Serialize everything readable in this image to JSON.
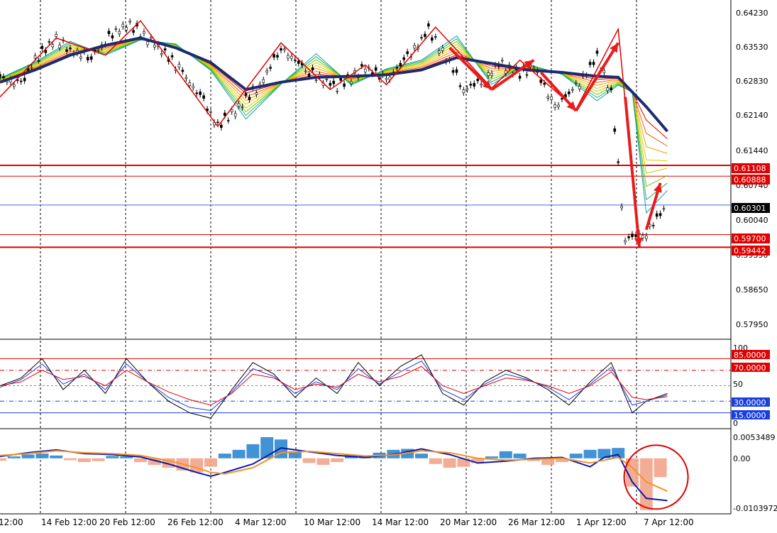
{
  "chart_data": {
    "type": "line",
    "title": "",
    "subtitle": "",
    "x_tick_labels": [
      "12:00",
      "14 Feb 12:00",
      "20 Feb 12:00",
      "26 Feb 12:00",
      "4 Mar 12:00",
      "10 Mar 12:00",
      "14 Mar 12:00",
      "20 Mar 12:00",
      "26 Mar 12:00",
      "1 Apr 12:00",
      "7 Apr 12:00"
    ],
    "price_panel": {
      "type": "line",
      "y_range": [
        0.576,
        0.644
      ],
      "y_tick_labels": [
        "0.64230",
        "0.63530",
        "0.62830",
        "0.62140",
        "0.61440",
        "0.60740",
        "0.60040",
        "0.59350",
        "0.58650",
        "0.57950"
      ],
      "y_tick_values": [
        0.6423,
        0.6353,
        0.6283,
        0.6214,
        0.6144,
        0.6074,
        0.6004,
        0.5935,
        0.5865,
        0.5795
      ],
      "grid": "vertical-dashed",
      "horizontal_levels": [
        {
          "value": 0.61108,
          "label": "0.61108",
          "color": "#e00000",
          "style": "solid-thick"
        },
        {
          "value": 0.60888,
          "label": "0.60888",
          "color": "#e00000",
          "style": "solid"
        },
        {
          "value": 0.60301,
          "label": "0.60301",
          "color": "#3a6fd8",
          "style": "current-price"
        },
        {
          "value": 0.597,
          "label": "0.59700",
          "color": "#e00000",
          "style": "solid"
        },
        {
          "value": 0.59442,
          "label": "0.59442",
          "color": "#e00000",
          "style": "solid-thick"
        }
      ],
      "series": [
        {
          "kind": "candles-path",
          "x_days": [
            0,
            3,
            5,
            8,
            10,
            13,
            15,
            18,
            22,
            26,
            29,
            31,
            34,
            37,
            40,
            44,
            48,
            52,
            55,
            58,
            61,
            64,
            66,
            69,
            71,
            74,
            76,
            79,
            82,
            85,
            87,
            89,
            92,
            95
          ],
          "values": [
            0.629,
            0.6275,
            0.6325,
            0.637,
            0.6345,
            0.633,
            0.6365,
            0.64,
            0.636,
            0.63,
            0.624,
            0.619,
            0.623,
            0.6275,
            0.635,
            0.63,
            0.627,
            0.631,
            0.6285,
            0.633,
            0.6385,
            0.632,
            0.6265,
            0.6285,
            0.632,
            0.6295,
            0.631,
            0.623,
            0.627,
            0.633,
            0.626,
            0.596,
            0.5975,
            0.603
          ]
        },
        {
          "kind": "moving-average",
          "name": "",
          "color": "#1c2b6e",
          "x_days": [
            0,
            5,
            10,
            15,
            20,
            25,
            30,
            35,
            40,
            45,
            50,
            55,
            60,
            65,
            70,
            75,
            80,
            85,
            88,
            90,
            92,
            95
          ],
          "values": [
            0.628,
            0.6305,
            0.6335,
            0.6355,
            0.637,
            0.635,
            0.632,
            0.6265,
            0.628,
            0.629,
            0.6292,
            0.6295,
            0.6305,
            0.633,
            0.6318,
            0.6305,
            0.63,
            0.6292,
            0.629,
            0.626,
            0.623,
            0.618
          ]
        }
      ],
      "zigzag_points": [
        {
          "day": 0,
          "value": 0.625
        },
        {
          "day": 8,
          "value": 0.637
        },
        {
          "day": 15,
          "value": 0.6335
        },
        {
          "day": 20,
          "value": 0.6405
        },
        {
          "day": 31,
          "value": 0.619
        },
        {
          "day": 40,
          "value": 0.636
        },
        {
          "day": 47,
          "value": 0.6265
        },
        {
          "day": 52,
          "value": 0.6315
        },
        {
          "day": 55,
          "value": 0.6275
        },
        {
          "day": 62,
          "value": 0.6392
        },
        {
          "day": 70,
          "value": 0.6268
        },
        {
          "day": 74,
          "value": 0.6325
        },
        {
          "day": 82,
          "value": 0.6225
        },
        {
          "day": 88,
          "value": 0.6388
        },
        {
          "day": 91,
          "value": 0.5945
        }
      ],
      "arrows": [
        {
          "from": [
            64,
            0.635
          ],
          "to": [
            70,
            0.6265
          ]
        },
        {
          "from": [
            70,
            0.6265
          ],
          "to": [
            76,
            0.6325
          ]
        },
        {
          "from": [
            77,
            0.63
          ],
          "to": [
            82,
            0.6222
          ]
        },
        {
          "from": [
            82,
            0.6222
          ],
          "to": [
            88,
            0.636
          ]
        },
        {
          "from": [
            89,
            0.625
          ],
          "to": [
            91,
            0.5945
          ]
        },
        {
          "from": [
            92,
            0.598
          ],
          "to": [
            94,
            0.6075
          ]
        }
      ]
    },
    "stochastic_panel": {
      "type": "line",
      "y_range": [
        0,
        100
      ],
      "y_tick_labels": [
        "100",
        "50",
        "0"
      ],
      "levels": [
        {
          "value": 85,
          "label": "85.0000",
          "color": "#e00000",
          "style": "solid"
        },
        {
          "value": 70,
          "label": "70.0000",
          "color": "#e00000",
          "style": "dashdot"
        },
        {
          "value": 50,
          "label": "",
          "color": "#888888",
          "style": "dashed"
        },
        {
          "value": 30,
          "label": "30.0000",
          "color": "#1a3fe0",
          "style": "dashdot"
        },
        {
          "value": 15,
          "label": "15.0000",
          "color": "#1a3fe0",
          "style": "solid"
        }
      ],
      "series": [
        {
          "name": "",
          "color": "#000000",
          "x_days": [
            0,
            3,
            6,
            9,
            12,
            15,
            18,
            21,
            24,
            27,
            30,
            33,
            36,
            39,
            42,
            45,
            48,
            51,
            54,
            57,
            60,
            63,
            66,
            69,
            72,
            75,
            78,
            81,
            84,
            87,
            90,
            92,
            95
          ],
          "values": [
            50,
            60,
            85,
            45,
            70,
            40,
            85,
            55,
            30,
            15,
            8,
            45,
            80,
            65,
            35,
            60,
            40,
            80,
            50,
            75,
            90,
            40,
            25,
            55,
            70,
            60,
            45,
            25,
            55,
            80,
            15,
            30,
            40
          ]
        },
        {
          "name": "",
          "color": "#1a3fe0",
          "x_days": [
            0,
            3,
            6,
            9,
            12,
            15,
            18,
            21,
            24,
            27,
            30,
            33,
            36,
            39,
            42,
            45,
            48,
            51,
            54,
            57,
            60,
            63,
            66,
            69,
            72,
            75,
            78,
            81,
            84,
            87,
            90,
            92,
            95
          ],
          "values": [
            48,
            58,
            78,
            52,
            65,
            45,
            78,
            55,
            35,
            22,
            18,
            42,
            72,
            62,
            40,
            55,
            45,
            72,
            52,
            68,
            82,
            45,
            32,
            52,
            65,
            58,
            48,
            32,
            52,
            74,
            25,
            30,
            38
          ]
        },
        {
          "name": "",
          "color": "#e00000",
          "x_days": [
            0,
            3,
            6,
            9,
            12,
            15,
            18,
            21,
            24,
            27,
            30,
            33,
            36,
            39,
            42,
            45,
            48,
            51,
            54,
            57,
            60,
            63,
            66,
            69,
            72,
            75,
            78,
            81,
            84,
            87,
            90,
            92,
            95
          ],
          "values": [
            50,
            55,
            70,
            58,
            62,
            50,
            70,
            55,
            42,
            32,
            25,
            40,
            65,
            60,
            45,
            52,
            48,
            65,
            55,
            62,
            75,
            50,
            40,
            50,
            60,
            57,
            50,
            40,
            50,
            68,
            35,
            32,
            36
          ]
        }
      ]
    },
    "macd_panel": {
      "type": "bar",
      "y_range": [
        -0.0115,
        0.006
      ],
      "y_tick_labels": [
        "0.0053489",
        "0.00",
        "-0.0103972"
      ],
      "histogram_days": [
        0,
        2,
        4,
        6,
        8,
        10,
        12,
        14,
        16,
        18,
        20,
        22,
        24,
        26,
        28,
        30,
        32,
        34,
        36,
        38,
        40,
        42,
        44,
        46,
        48,
        50,
        52,
        54,
        56,
        58,
        60,
        62,
        64,
        66,
        68,
        70,
        72,
        74,
        76,
        78,
        80,
        82,
        84,
        86,
        88,
        90,
        92,
        94
      ],
      "histogram_values": [
        -0.0005,
        0.0004,
        0.0008,
        0.001,
        0.0006,
        -0.0004,
        -0.0008,
        -0.0006,
        0.0005,
        0.0004,
        -0.0008,
        -0.0014,
        -0.002,
        -0.0026,
        -0.003,
        -0.0018,
        0.001,
        0.0018,
        0.003,
        0.0045,
        0.004,
        0.0015,
        -0.001,
        -0.0014,
        -0.0008,
        0.0008,
        0.0006,
        0.0012,
        0.0018,
        0.002,
        0.001,
        -0.0012,
        -0.002,
        -0.0018,
        -0.001,
        0.0004,
        0.0015,
        0.001,
        -0.0006,
        -0.0014,
        -0.0008,
        0.001,
        0.0018,
        0.002,
        0.0022,
        -0.006,
        -0.011,
        -0.004
      ],
      "positive_color": "#2e86d1",
      "negative_color": "#f2a48a",
      "series": [
        {
          "name": "",
          "color": "#0b1aa8",
          "x_days": [
            0,
            4,
            8,
            12,
            16,
            20,
            24,
            28,
            30,
            32,
            36,
            40,
            44,
            48,
            52,
            56,
            60,
            64,
            68,
            72,
            76,
            80,
            84,
            86,
            88,
            90,
            92,
            95
          ],
          "values": [
            0.0004,
            0.0012,
            0.0018,
            0.001,
            0.0008,
            0.0003,
            -0.0012,
            -0.003,
            -0.0038,
            -0.003,
            -0.0012,
            0.0022,
            0.0014,
            0.0006,
            0.0002,
            0.0008,
            0.002,
            0.0008,
            -0.001,
            -0.0006,
            0.0,
            0.0002,
            -0.0018,
            0.0002,
            0.0008,
            -0.005,
            -0.0085,
            -0.009
          ]
        },
        {
          "name": "",
          "color": "#f2932a",
          "x_days": [
            0,
            4,
            8,
            12,
            16,
            20,
            24,
            28,
            30,
            32,
            36,
            40,
            44,
            48,
            52,
            56,
            60,
            64,
            68,
            72,
            76,
            80,
            84,
            86,
            88,
            90,
            92,
            95
          ],
          "values": [
            0.0006,
            0.001,
            0.0016,
            0.0012,
            0.001,
            0.0006,
            -0.0005,
            -0.002,
            -0.003,
            -0.0033,
            -0.002,
            0.0012,
            0.0015,
            0.001,
            0.0005,
            0.0007,
            0.0016,
            0.0012,
            0.0,
            -0.0004,
            -0.0002,
            0.0,
            -0.001,
            -0.0004,
            0.0002,
            -0.002,
            -0.005,
            -0.007
          ]
        }
      ]
    },
    "annotation_circle": {
      "center_day": 94,
      "center_value": -0.004,
      "color": "#e00000"
    }
  }
}
